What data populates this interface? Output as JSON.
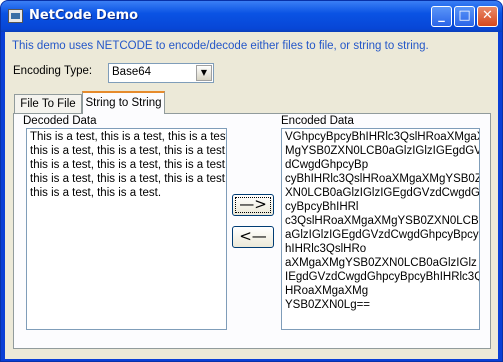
{
  "window": {
    "title": "NetCode Demo",
    "minimize_label": "_",
    "maximize_label": "□",
    "close_label": "✕"
  },
  "description": "This demo uses NETCODE to encode/decode either files to file, or string to string.",
  "encoding": {
    "label": "Encoding Type:",
    "selected": "Base64",
    "dropdown_glyph": "▼"
  },
  "tabs": [
    {
      "label": "File To File",
      "active": false
    },
    {
      "label": "String to String",
      "active": true
    }
  ],
  "panel": {
    "decoded_label": "Decoded Data",
    "encoded_label": "Encoded Data",
    "decoded_text": "This is a test, this is a test, this is a test,\nthis is a test, this is a test, this is a test,\nthis is a test, this is a test, this is a test,\nthis is a test, this is a test, this is a test,\nthis is a test, this is a test.",
    "encoded_text": "VGhpcyBpcyBhIHRlc3QslHRoaXMgaX\nMgYSB0ZXN0LCB0aGlzIGlzIGEgdGVz\ndCwgdGhpcyBp\ncyBhIHRlc3QslHRoaXMgaXMgYSB0Z\nXN0LCB0aGlzIGlzIGEgdGVzdCwgdGhp\ncyBpcyBhIHRl\nc3QslHRoaXMgaXMgYSB0ZXN0LCB0\naGlzIGlzIGEgdGVzdCwgdGhpcyBpcyB\nhIHRlc3QslHRo\naXMgaXMgYSB0ZXN0LCB0aGlzIGlz\nIEgdGVzdCwgdGhpcyBpcyBhIHRlc3Qsl\nHRoaXMgaXMg\nYSB0ZXN0Lg==",
    "encode_button": "—>",
    "decode_button": "<—"
  }
}
